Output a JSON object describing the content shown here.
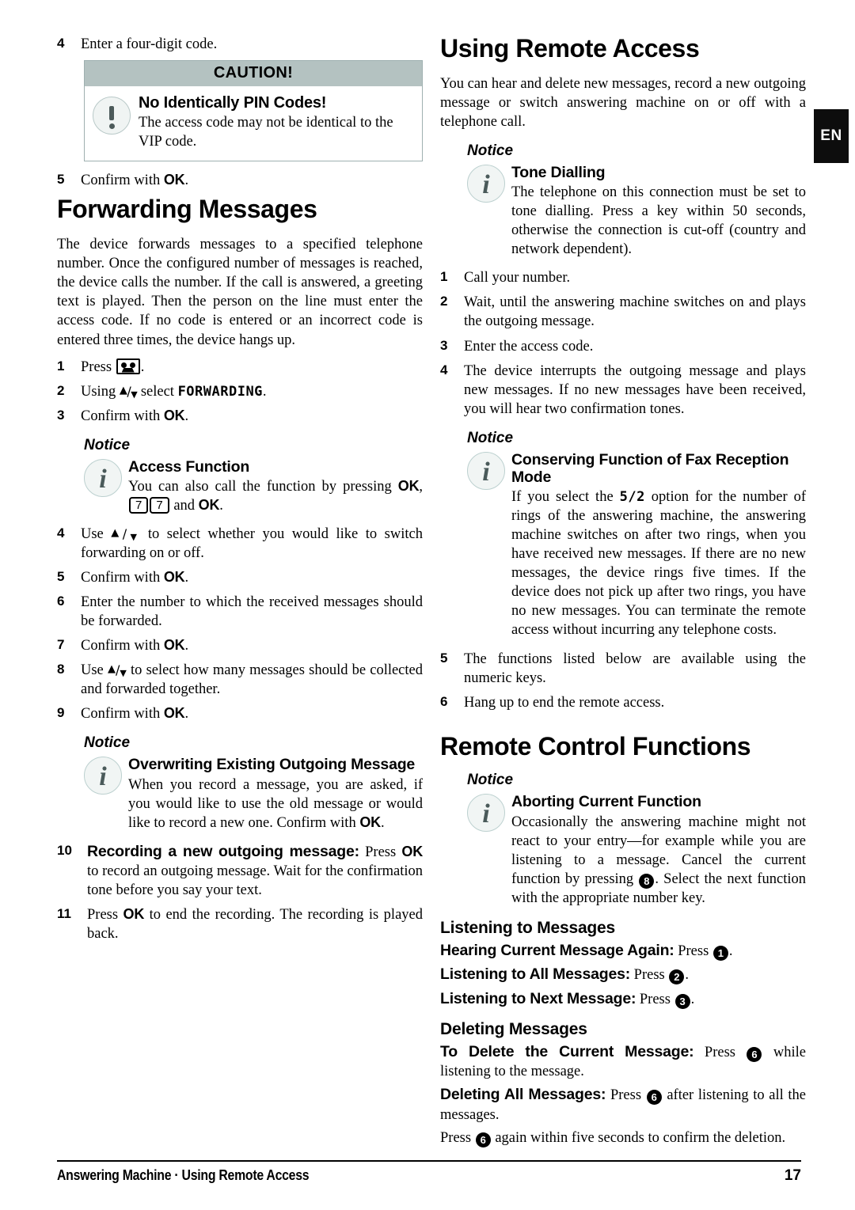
{
  "lang_tab": "EN",
  "left_column": {
    "step4": {
      "num": "4",
      "text": "Enter a four-digit code."
    },
    "caution": {
      "header": "CAUTION!",
      "icon": "exclamation-icon",
      "title": "No Identically PIN Codes!",
      "desc": "The access code may not be identical to the VIP code."
    },
    "step5": {
      "num": "5",
      "pre": "Confirm with ",
      "key": "OK",
      "post": "."
    },
    "heading": "Forwarding Messages",
    "intro": "The device forwards messages to a specified telephone number. Once the configured number of messages is reached, the device calls the number. If the call is answered, a greeting text is played. Then the person on the line must enter the access code. If no code is entered or an incorrect code is entered three times, the device hangs up.",
    "steps_1_3": [
      {
        "num": "1",
        "pre": "Press ",
        "icon": "cassette-icon",
        "post": "."
      },
      {
        "num": "2",
        "pre": "Using ",
        "arrows": "▲/▼",
        "mid": " select ",
        "lcd": "FORWARDING",
        "post": "."
      },
      {
        "num": "3",
        "pre": "Confirm with ",
        "key": "OK",
        "post": "."
      }
    ],
    "notice_access": {
      "label": "Notice",
      "icon": "info-icon",
      "title": "Access Function",
      "desc_pre": "You can also call the function by pressing ",
      "key1": "OK",
      "comma": ", ",
      "keybox1": "7",
      "keybox2": "7",
      "desc_mid": " and ",
      "key2": "OK",
      "post": "."
    },
    "steps_4_9": [
      {
        "num": "4",
        "pre": "Use ",
        "arrows": "▲/▼",
        "post": " to select whether you would like to switch forwarding on or off."
      },
      {
        "num": "5",
        "pre": "Confirm with ",
        "key": "OK",
        "post": "."
      },
      {
        "num": "6",
        "pre": "Enter the number to which the received messages should be forwarded.",
        "post": ""
      },
      {
        "num": "7",
        "pre": "Confirm with ",
        "key": "OK",
        "post": "."
      },
      {
        "num": "8",
        "pre": "Use ",
        "arrows": "▲/▼",
        "post": " to select how many messages should be collected and forwarded together."
      },
      {
        "num": "9",
        "pre": "Confirm with ",
        "key": "OK",
        "post": "."
      }
    ],
    "notice_overwrite": {
      "label": "Notice",
      "icon": "info-icon",
      "title": "Overwriting Existing Outgoing Message",
      "desc_pre": "When you record a message, you are asked, if you would like to use the old message or would like to record a new one. Confirm with ",
      "key": "OK",
      "post": "."
    },
    "step10": {
      "num": "10",
      "lead": "Recording a new outgoing message:",
      "mid": " Press ",
      "key": "OK",
      "post": " to record an outgoing message. Wait for the confirmation tone before you say your text."
    },
    "step11": {
      "num": "11",
      "pre": "Press ",
      "key": "OK",
      "post": " to end the recording. The recording is played back."
    }
  },
  "right_column": {
    "heading": "Using Remote Access",
    "intro": "You can hear and delete new messages, record a new outgoing message or switch answering machine on or off with a telephone call.",
    "notice_tone": {
      "label": "Notice",
      "icon": "info-icon",
      "title": "Tone Dialling",
      "desc": "The telephone on this connection must be set to tone dialling. Press a key within 50 seconds, otherwise the connection is cut-off (country and network dependent)."
    },
    "steps_1_4": [
      {
        "num": "1",
        "text": "Call your number."
      },
      {
        "num": "2",
        "text": "Wait, until the answering machine switches on and plays the outgoing message."
      },
      {
        "num": "3",
        "text": "Enter the access code."
      },
      {
        "num": "4",
        "text": "The device interrupts the outgoing message and plays new messages. If no new messages have been received, you will hear two confirmation tones."
      }
    ],
    "notice_conserving": {
      "label": "Notice",
      "icon": "info-icon",
      "title": "Conserving Function of Fax Reception Mode",
      "desc_pre": "If you select the ",
      "lcd": "5/2",
      "desc_post": " option for the number of rings of the answering machine, the answering machine switches on after two rings, when you have received new messages. If there are no new messages, the device rings five times. If the device does not pick up after two rings, you have no new messages. You can terminate the remote access without incurring any telephone costs."
    },
    "steps_5_6": [
      {
        "num": "5",
        "text": "The functions listed below are available using the numeric keys."
      },
      {
        "num": "6",
        "text": "Hang up to end the remote access."
      }
    ],
    "heading2": "Remote Control Functions",
    "notice_abort": {
      "label": "Notice",
      "icon": "info-icon",
      "title": "Aborting Current Function",
      "desc_pre": "Occasionally the answering machine might not react to your entry—for example while you are listening to a message. Cancel the current function by pressing ",
      "numkey": "8",
      "desc_post": ". Select the next function with the appropriate number key."
    },
    "listening_heading": "Listening to Messages",
    "listening_items": [
      {
        "lead": "Hearing Current Message Again:",
        "mid": " Press ",
        "numkey": "1",
        "post": "."
      },
      {
        "lead": "Listening to All Messages:",
        "mid": " Press ",
        "numkey": "2",
        "post": "."
      },
      {
        "lead": "Listening to Next Message:",
        "mid": " Press ",
        "numkey": "3",
        "post": "."
      }
    ],
    "deleting_heading": "Deleting Messages",
    "deleting_items": [
      {
        "lead": "To Delete the Current Message:",
        "mid": " Press ",
        "numkey": "6",
        "post": " while listening to the message."
      },
      {
        "lead": "Deleting All Messages:",
        "mid": " Press ",
        "numkey": "6",
        "post": " after listening to all the messages."
      }
    ],
    "deleting_confirm": {
      "pre": "Press ",
      "numkey": "6",
      "post": " again within five seconds to confirm the deletion."
    }
  },
  "footer": {
    "left": "Answering Machine · Using Remote Access",
    "page": "17"
  }
}
